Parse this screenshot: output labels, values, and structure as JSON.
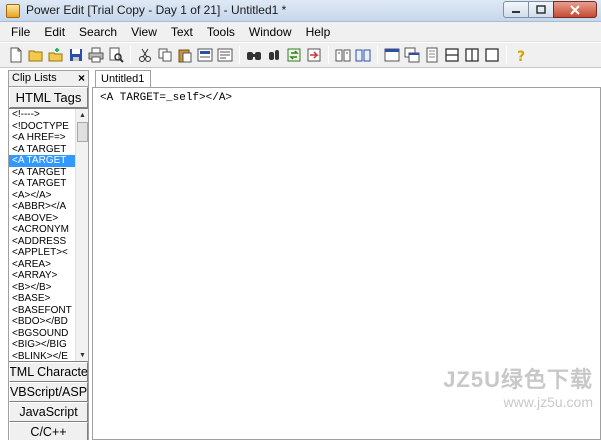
{
  "window": {
    "title": "Power Edit [Trial Copy - Day 1 of 21] - Untitled1 *"
  },
  "menu": [
    "File",
    "Edit",
    "Search",
    "View",
    "Text",
    "Tools",
    "Window",
    "Help"
  ],
  "toolbar_icons": [
    "new-file-icon",
    "open-folder-icon",
    "open-recent-icon",
    "save-icon",
    "print-icon",
    "print-preview-icon",
    "cut-icon",
    "copy-icon",
    "paste-icon",
    "toggle-a-icon",
    "toggle-b-icon",
    "find-icon",
    "find-next-icon",
    "replace-icon",
    "goto-icon",
    "book-icon",
    "book-open-icon",
    "window-tile-icon",
    "window-cascade-icon",
    "page-icon",
    "split-horizontal-icon",
    "split-vertical-icon",
    "single-pane-icon",
    "help-icon"
  ],
  "clip_panel": {
    "title": "Clip Lists",
    "close": "×",
    "categories_top": [
      "HTML Tags"
    ],
    "tags": [
      "<!---->",
      "<!DOCTYPE",
      "<A HREF=>",
      "<A TARGET",
      "<A TARGET",
      "<A TARGET",
      "<A TARGET",
      "<A></A>",
      "<ABBR></A",
      "<ABOVE>",
      "<ACRONYM",
      "<ADDRESS",
      "<APPLET><",
      "<AREA>",
      "<ARRAY>",
      "<B></B>",
      "<BASE>",
      "<BASEFONT",
      "<BDO></BD",
      "<BGSOUND",
      "<BIG></BIG",
      "<BLINK></E"
    ],
    "selected_index": 4,
    "categories_bottom": [
      "TML Characte",
      "VBScript/ASP",
      "JavaScript",
      "C/C++"
    ]
  },
  "editor": {
    "tab_label": "Untitled1 *",
    "content": "<A TARGET=_self></A>"
  },
  "watermark": {
    "line1": "JZ5U绿色下载",
    "line2": "www.jz5u.com"
  },
  "colors": {
    "selection": "#3399ff",
    "chrome": "#f0f0f0"
  }
}
